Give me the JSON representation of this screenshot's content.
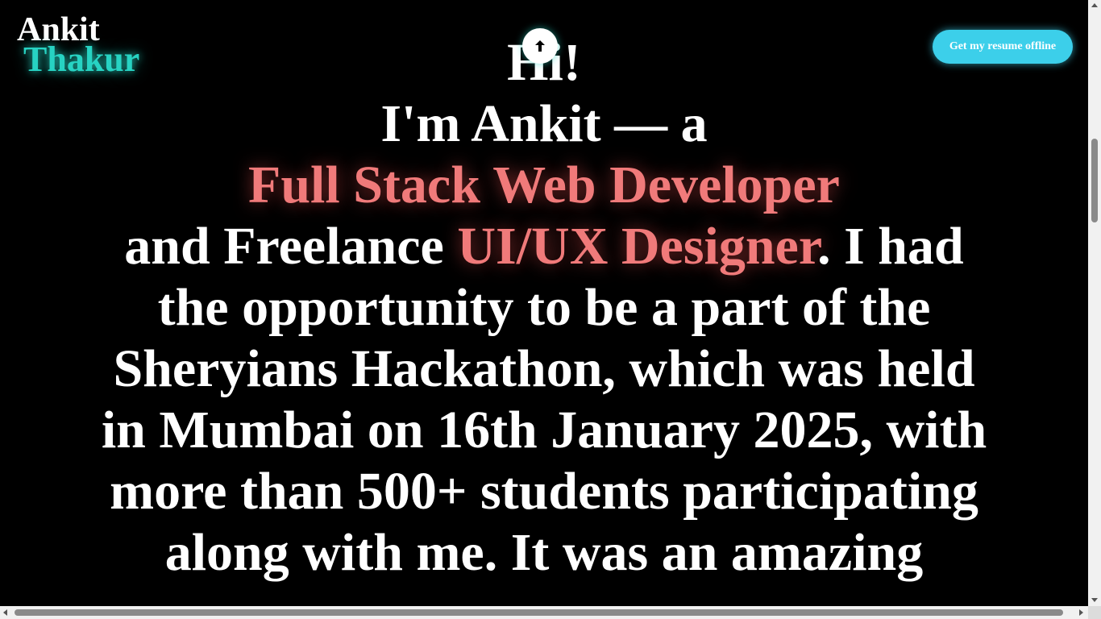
{
  "logo": {
    "first": "Ankit",
    "last": "Thakur"
  },
  "header": {
    "resume_button": "Get my resume offline"
  },
  "scroll_top": {
    "icon": "arrow-up-icon"
  },
  "hero": {
    "greeting": "Hi!",
    "intro": "I'm Ankit — a",
    "role_primary": "Full Stack Web Developer",
    "connector": "and Freelance ",
    "role_secondary": "UI/UX Designer",
    "after_role": ". I had",
    "lines": [
      "the opportunity to be a part of the",
      "Sheryians Hackathon, which was held",
      "in Mumbai on 16th January 2025, with",
      "more than 500+ students participating",
      "along with me. It was an amazing"
    ]
  },
  "colors": {
    "accent_teal": "#27d3c3",
    "accent_red": "#f07a7a",
    "button": "#3ccfea",
    "background": "#000000"
  }
}
